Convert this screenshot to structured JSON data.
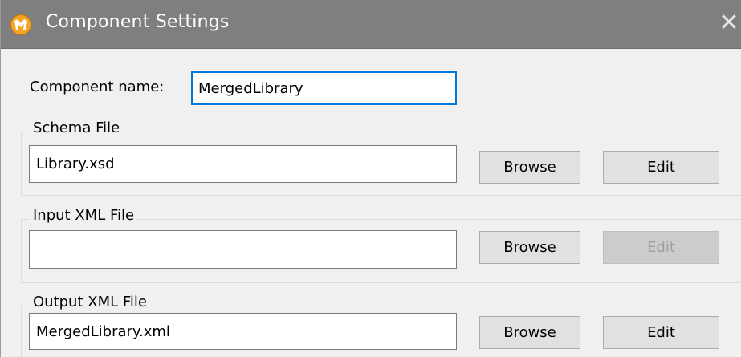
{
  "window": {
    "title": "Component Settings",
    "close_glyph": "✕",
    "app_icon": "altova-mapforce-icon"
  },
  "component_name": {
    "label": "Component name:",
    "value": "MergedLibrary"
  },
  "schema_file": {
    "group_label": "Schema File",
    "value": "Library.xsd",
    "browse_label": "Browse",
    "edit_label": "Edit",
    "edit_enabled": true
  },
  "input_xml_file": {
    "group_label": "Input XML File",
    "value": "",
    "browse_label": "Browse",
    "edit_label": "Edit",
    "edit_enabled": false
  },
  "output_xml_file": {
    "group_label": "Output XML File",
    "value": "MergedLibrary.xml",
    "browse_label": "Browse",
    "edit_label": "Edit",
    "edit_enabled": true
  },
  "colors": {
    "titlebar": "#7f7f7f",
    "focus_border": "#0078d7",
    "dialog_bg": "#f0f0f0"
  }
}
